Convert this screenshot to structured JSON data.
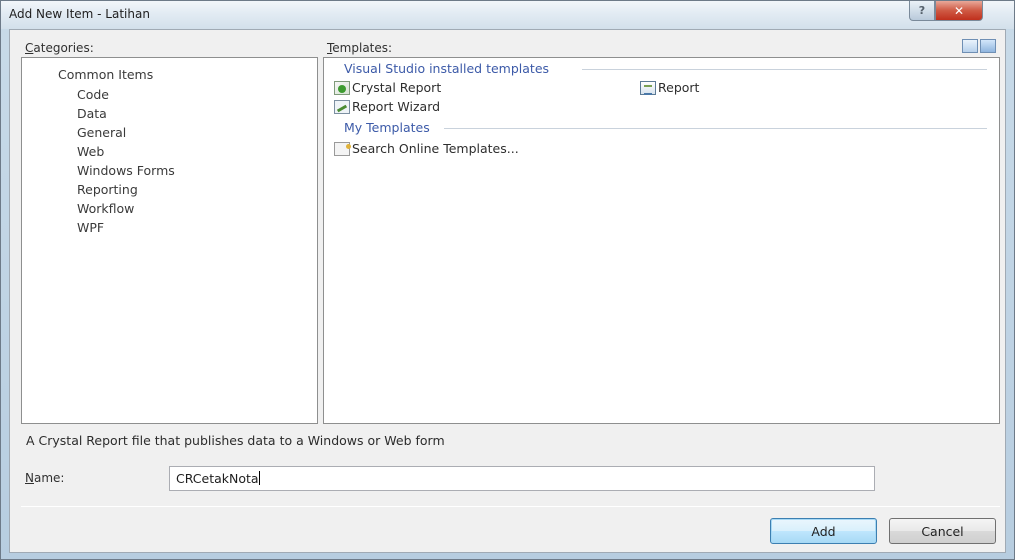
{
  "window": {
    "title": "Add New Item - Latihan",
    "help_label": "?",
    "close_label": "✕"
  },
  "categories": {
    "label": "Categories:",
    "label_mnemonic": "C",
    "label_rest": "ategories:",
    "root": "Common Items",
    "items": [
      "Code",
      "Data",
      "General",
      "Web",
      "Windows Forms",
      "Reporting",
      "Workflow",
      "WPF"
    ],
    "selected": "Reporting"
  },
  "templates": {
    "label_mnemonic": "T",
    "label_rest": "emplates:",
    "installed_heading": "Visual Studio installed templates",
    "installed_items": [
      {
        "label": "Crystal Report",
        "icon": "crystal-report-icon"
      },
      {
        "label": "Report",
        "icon": "report-icon"
      },
      {
        "label": "Report Wizard",
        "icon": "report-wizard-icon"
      }
    ],
    "my_heading": "My Templates",
    "my_items": [
      {
        "label": "Search Online Templates...",
        "icon": "search-online-icon"
      }
    ],
    "view_modes": [
      "large-icons-view-icon",
      "small-icons-view-icon"
    ]
  },
  "description": "A Crystal Report file that publishes data to a Windows or Web form",
  "name_field": {
    "label_mnemonic": "N",
    "label_rest": "ame:",
    "value": "CRCetakNota"
  },
  "buttons": {
    "add": "Add",
    "cancel": "Cancel"
  },
  "colors": {
    "group_heading": "#3c5aa8",
    "close_button": "#c0301d"
  }
}
